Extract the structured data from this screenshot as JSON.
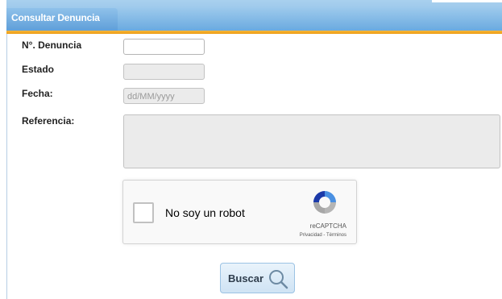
{
  "header": {
    "tab_title": "Consultar Denuncia",
    "colors": {
      "tab_blue": "#6aaae0",
      "accent_orange": "#ec9c14"
    }
  },
  "form": {
    "numero": {
      "label": "N°. Denuncia",
      "value": ""
    },
    "estado": {
      "label": "Estado",
      "value": ""
    },
    "fecha": {
      "label": "Fecha:",
      "placeholder": "dd/MM/yyyy",
      "value": ""
    },
    "referencia": {
      "label": "Referencia:",
      "value": ""
    }
  },
  "captcha": {
    "label": "No soy un robot",
    "brand": "reCAPTCHA",
    "links": "Privacidad - Términos",
    "icon": "recaptcha-logo-icon"
  },
  "actions": {
    "search_label": "Buscar",
    "search_icon": "magnifier-icon"
  }
}
